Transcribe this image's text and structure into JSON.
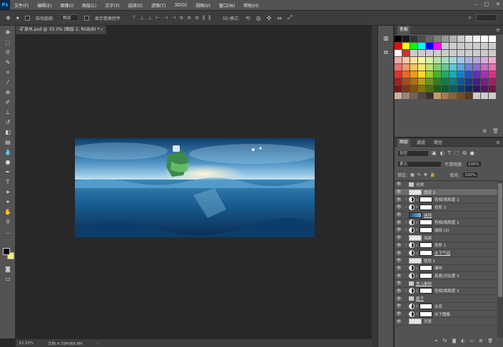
{
  "app": {
    "logo": "Ps"
  },
  "menu": [
    "文件(F)",
    "编辑(E)",
    "图像(I)",
    "图层(L)",
    "文字(Y)",
    "选择(S)",
    "滤镜(T)",
    "3D(D)",
    "视图(V)",
    "窗口(W)",
    "帮助(H)"
  ],
  "options": {
    "auto_select_label": "自动选择:",
    "auto_select_value": "图层",
    "show_transform_label": "显示变换控件",
    "mode_3d_label": "3D 模式:"
  },
  "document": {
    "tab_title": "矿泉水.psd @ 33.3% (图层 2, RGB/8) *",
    "close": "×"
  },
  "status": {
    "zoom": "33.33%",
    "doc_size": "文档:4.39M/68.8M"
  },
  "swatches": {
    "tab": "色板",
    "colors": [
      "#000000",
      "#1a1a1a",
      "#333333",
      "#4d4d4d",
      "#666666",
      "#808080",
      "#999999",
      "#b3b3b3",
      "#cccccc",
      "#e6e6e6",
      "#f2f2f2",
      "#ffffff",
      "#ffffff",
      "#ff0000",
      "#ffff00",
      "#00ff00",
      "#00ffff",
      "#0000ff",
      "#ff00ff",
      "#cccccc",
      "#cccccc",
      "#cccccc",
      "#cccccc",
      "#cccccc",
      "#cccccc",
      "#cccccc",
      "#ffffff",
      "#cc3333",
      "#cccccc",
      "#cccccc",
      "#cccccc",
      "#cccccc",
      "#cccccc",
      "#cccccc",
      "#cccccc",
      "#cccccc",
      "#cccccc",
      "#cccccc",
      "#cccccc",
      "#f4a9a9",
      "#f7c6a3",
      "#fbe3a0",
      "#fdf6a6",
      "#d9efa3",
      "#b7e2a5",
      "#a7dcc0",
      "#a3dce0",
      "#a2c6ea",
      "#a7b3e6",
      "#bba7e0",
      "#d9a8e0",
      "#f0a9d0",
      "#ee6e6e",
      "#f29a6a",
      "#f7c45e",
      "#fbe96c",
      "#bfe06d",
      "#84cc72",
      "#66c59a",
      "#5fc7cf",
      "#5da4dd",
      "#6a7fd5",
      "#8f6bcb",
      "#c36ccc",
      "#e56fae",
      "#e62e2e",
      "#ec6b2a",
      "#f29a17",
      "#f8db1f",
      "#9fcf2b",
      "#47b433",
      "#22aa6a",
      "#14aebb",
      "#1480cc",
      "#2a50c2",
      "#5f2fb3",
      "#a42fb6",
      "#d82f86",
      "#a61e1e",
      "#aa4b1b",
      "#b06f0c",
      "#b4a012",
      "#6f951d",
      "#2c8023",
      "#137a4b",
      "#0b7d87",
      "#0b5b94",
      "#1b388c",
      "#431f82",
      "#761f84",
      "#9c1f60",
      "#7a1414",
      "#7e3611",
      "#825106",
      "#84760b",
      "#516d13",
      "#1e5e17",
      "#0c5a36",
      "#075c63",
      "#07426d",
      "#122866",
      "#30155f",
      "#561561",
      "#731546",
      "#c7b299",
      "#998675",
      "#736357",
      "#534741",
      "#37302c",
      "#c69c6d",
      "#a67c52",
      "#8c6239",
      "#754c24",
      "#603913",
      "#cccccc",
      "#cccccc",
      "#cccccc"
    ]
  },
  "layers_panel": {
    "tabs": [
      "图层",
      "通道",
      "路径"
    ],
    "kind": "类型",
    "blend_mode": "柔光",
    "opacity_label": "不透明度:",
    "opacity": "100%",
    "fill_label": "填充:",
    "fill": "100%",
    "lock_label": "锁定:",
    "layers": [
      {
        "name": "光效",
        "type": "group",
        "indent": false,
        "selected": false,
        "underline": false
      },
      {
        "name": "图层 2",
        "type": "checker",
        "indent": false,
        "selected": true,
        "underline": false
      },
      {
        "name": "色相/饱和度 2",
        "type": "adjust",
        "indent": true,
        "selected": false,
        "underline": false
      },
      {
        "name": "色阶 2",
        "type": "adjust",
        "indent": true,
        "selected": false,
        "underline": false
      },
      {
        "name": "曲线",
        "type": "image",
        "indent": false,
        "selected": false,
        "underline": true
      },
      {
        "name": "色相/饱和度 1",
        "type": "adjust",
        "indent": true,
        "selected": false,
        "underline": false
      },
      {
        "name": "波纹 (2)",
        "type": "adjust",
        "indent": true,
        "selected": false,
        "underline": false
      },
      {
        "name": "海面",
        "type": "checker",
        "indent": false,
        "selected": false,
        "underline": false
      },
      {
        "name": "色阶 1",
        "type": "adjust",
        "indent": true,
        "selected": false,
        "underline": false
      },
      {
        "name": "水下气泡",
        "type": "adjust",
        "indent": false,
        "selected": false,
        "underline": true
      },
      {
        "name": "图层 1",
        "type": "checker",
        "indent": false,
        "selected": false,
        "underline": false
      },
      {
        "name": "瀑布",
        "type": "adjust",
        "indent": false,
        "selected": false,
        "underline": false
      },
      {
        "name": "亮度/对比度 3",
        "type": "adjust",
        "indent": false,
        "selected": false,
        "underline": false
      },
      {
        "name": "鱼儿素材",
        "type": "group",
        "indent": false,
        "selected": false,
        "underline": true
      },
      {
        "name": "色相/饱和度 3",
        "type": "adjust",
        "indent": true,
        "selected": false,
        "underline": false
      },
      {
        "name": "瓶子",
        "type": "group",
        "indent": false,
        "selected": false,
        "underline": true
      },
      {
        "name": "水花",
        "type": "adjust",
        "indent": false,
        "selected": false,
        "underline": false
      },
      {
        "name": "水下图像",
        "type": "adjust",
        "indent": false,
        "selected": false,
        "underline": false
      },
      {
        "name": "背景",
        "type": "checker",
        "indent": false,
        "selected": false,
        "underline": false
      }
    ]
  }
}
